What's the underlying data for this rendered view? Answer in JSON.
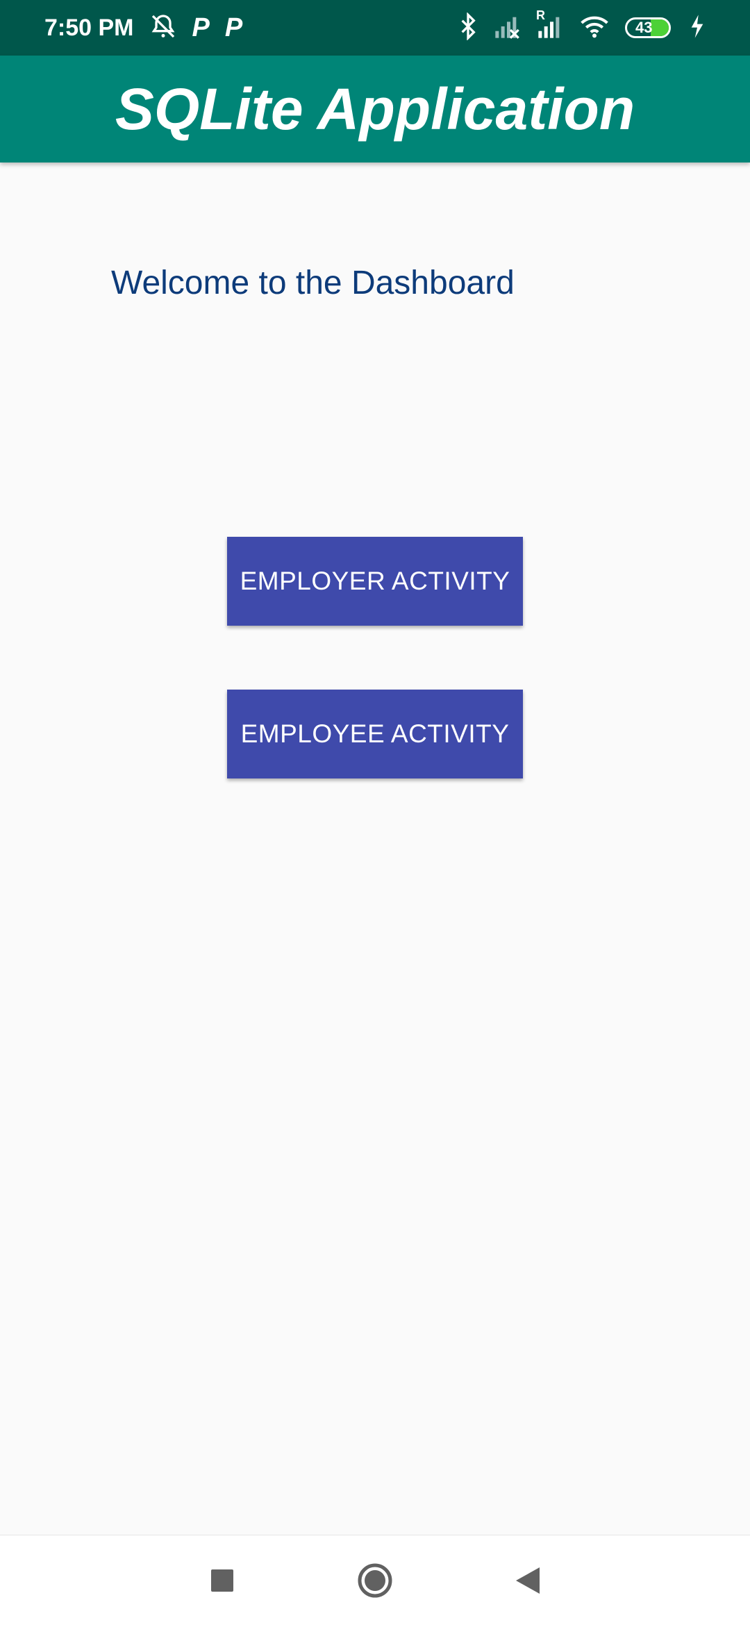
{
  "status_bar": {
    "time": "7:50 PM",
    "icons": [
      "alarm-off-icon",
      "p-icon",
      "p-icon",
      "bluetooth-icon",
      "signal-icon",
      "signal-roaming-icon",
      "wifi-icon",
      "battery-icon",
      "charging-icon"
    ],
    "p_label": "P",
    "roaming_label": "R",
    "battery_level": "43"
  },
  "app_bar": {
    "title": "SQLite Application",
    "color": "#008577"
  },
  "main": {
    "welcome_text": "Welcome to the Dashboard",
    "buttons": [
      {
        "label": "EMPLOYER ACTIVITY"
      },
      {
        "label": "EMPLOYEE ACTIVITY"
      }
    ],
    "button_color": "#3f4aab"
  },
  "nav_bar": {
    "items": [
      "recents-icon",
      "home-icon",
      "back-icon"
    ]
  }
}
